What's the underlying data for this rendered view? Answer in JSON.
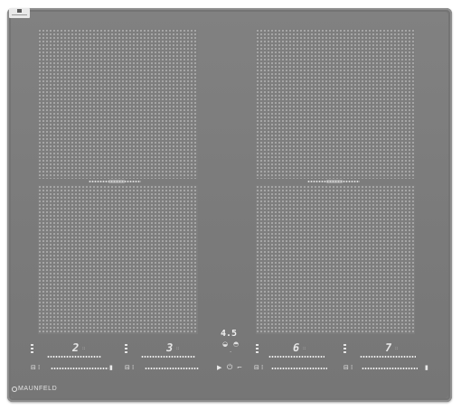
{
  "product": {
    "brand": "MAUNFELD",
    "colors": {
      "glass": "#7b7b7b",
      "dots": "#cdcdcd",
      "display": "#ececec"
    }
  },
  "zones": [
    {
      "id": "front-left",
      "level": "2"
    },
    {
      "id": "back-left-linked",
      "level": "3"
    },
    {
      "id": "front-right",
      "level": "6"
    },
    {
      "id": "back-right-linked",
      "level": "7"
    }
  ],
  "timer": {
    "value": "4.5"
  },
  "icons": {
    "lock": "lock-icon",
    "power": "power-icon",
    "pause": "pause-icon",
    "bridge": "bridge-icon",
    "boost": "boost-icon"
  }
}
